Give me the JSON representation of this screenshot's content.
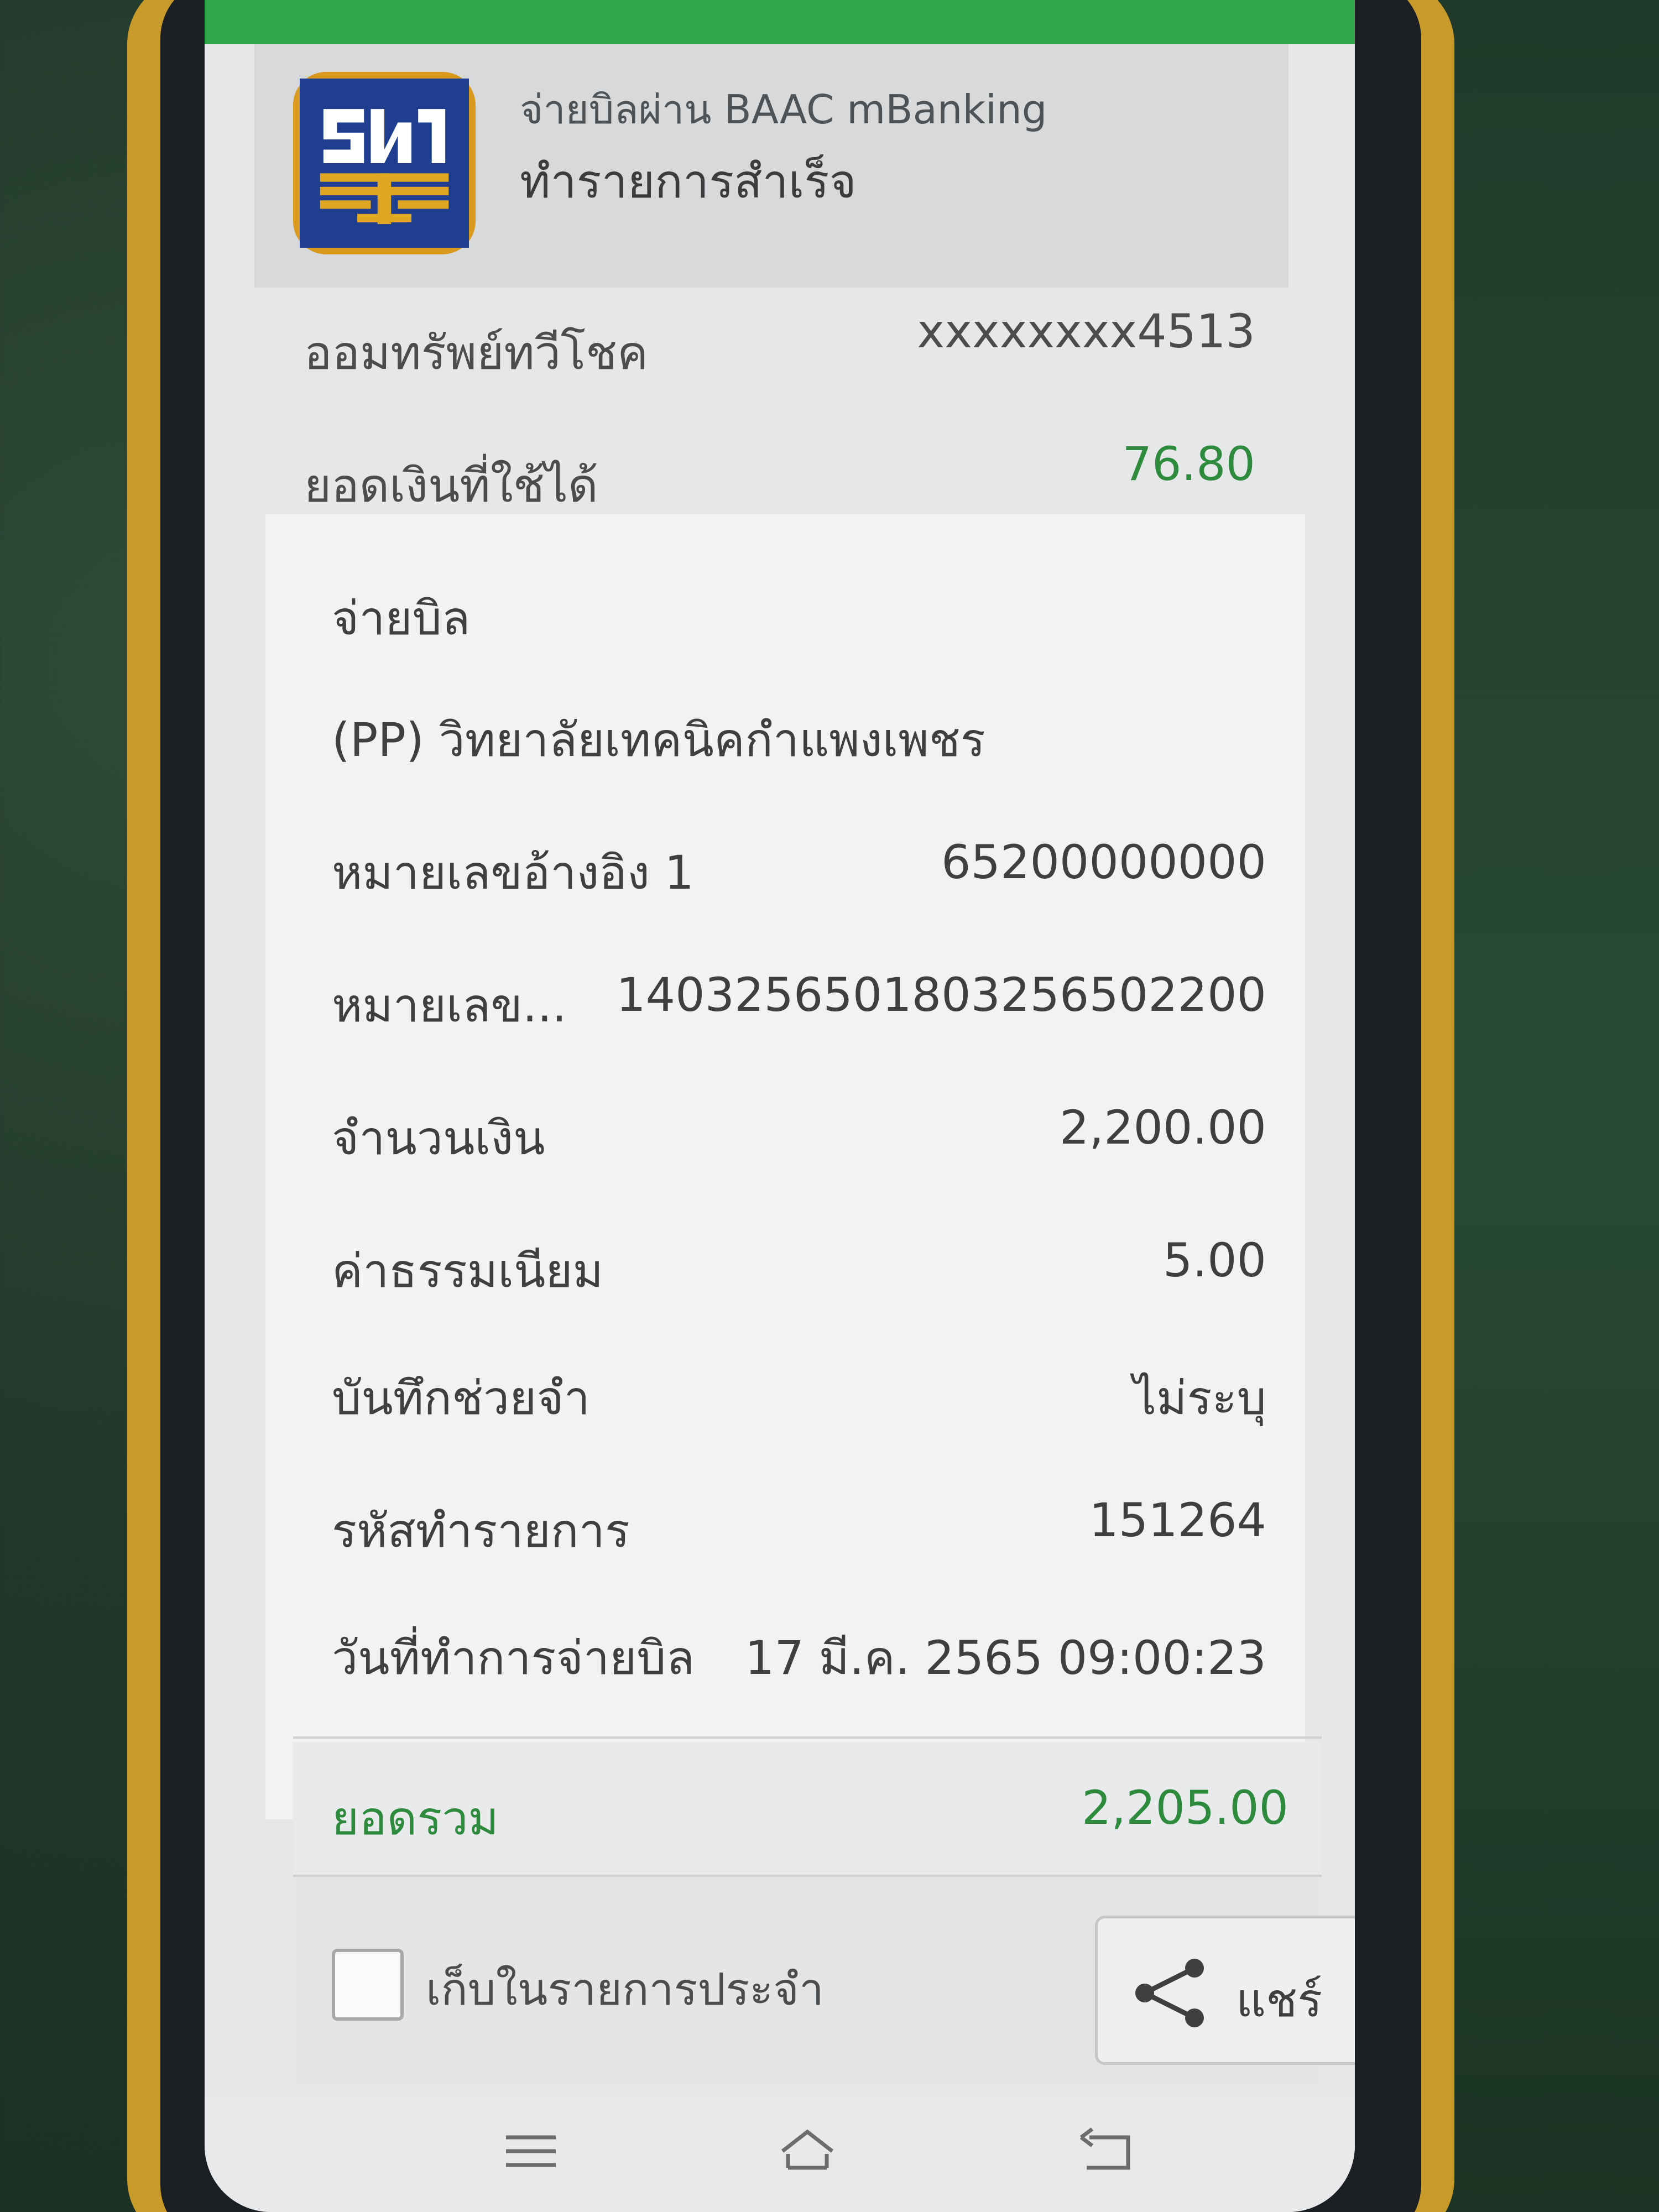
{
  "header": {
    "subtitle": "จ่ายบิลผ่าน BAAC mBanking",
    "title": "ทำรายการสำเร็จ",
    "logo_icon": "baac-logo-icon"
  },
  "account": {
    "type_label": "ออมทรัพย์ทวีโชค",
    "number": "xxxxxxxx4513",
    "balance_label": "ยอดเงินที่ใช้ได้",
    "balance_value": "76.80"
  },
  "details": {
    "section_title": "จ่ายบิล",
    "biller_name": "(PP) วิทยาลัยเทคนิคกำแพงเพชร",
    "rows": [
      {
        "label": "หมายเลขอ้างอิง 1",
        "value": "65200000000"
      },
      {
        "label": "หมายเลข...",
        "value": "140325650180325650220​0"
      },
      {
        "label": "จำนวนเงิน",
        "value": "2,200.00"
      },
      {
        "label": "ค่าธรรมเนียม",
        "value": "5.00"
      },
      {
        "label": "บันทึกช่วยจำ",
        "value": "ไม่ระบุ"
      },
      {
        "label": "รหัสทำรายการ",
        "value": "151264"
      },
      {
        "label": "วันที่ทำการจ่ายบิล",
        "value": "17 มี.ค. 2565 09:00:23"
      }
    ]
  },
  "total": {
    "label": "ยอดรวม",
    "value": "2,205.00"
  },
  "actions": {
    "favorite_label": "เก็บในรายการประจำ",
    "share_label": "แชร์"
  },
  "colors": {
    "accent_green": "#2e8b3e",
    "status_green": "#2fa64a",
    "logo_blue": "#1f3e8f",
    "logo_gold": "#d99a1d"
  }
}
